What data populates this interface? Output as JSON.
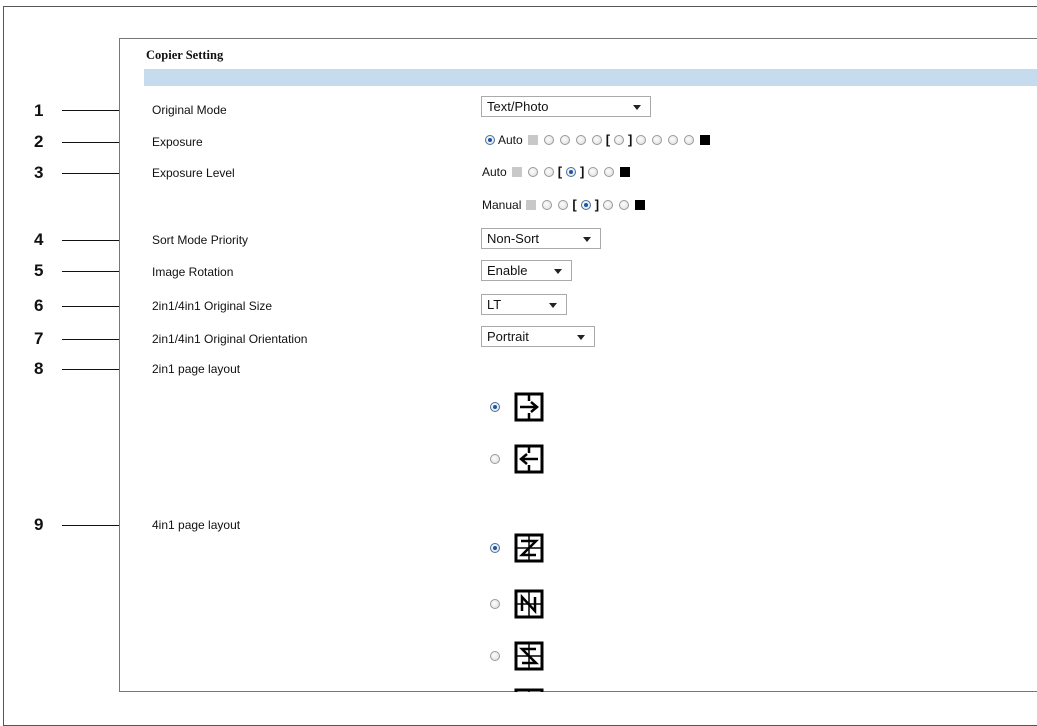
{
  "panel": {
    "title": "Copier Setting"
  },
  "callouts": [
    "1",
    "2",
    "3",
    "4",
    "5",
    "6",
    "7",
    "8",
    "9"
  ],
  "rows": {
    "original_mode": {
      "label": "Original Mode",
      "value": "Text/Photo"
    },
    "exposure": {
      "label": "Exposure",
      "auto_label": "Auto",
      "selected": "Auto"
    },
    "exposure_level": {
      "label": "Exposure Level",
      "auto_label": "Auto",
      "manual_label": "Manual"
    },
    "sort_mode_priority": {
      "label": "Sort Mode Priority",
      "value": "Non-Sort"
    },
    "image_rotation": {
      "label": "Image Rotation",
      "value": "Enable"
    },
    "original_size": {
      "label": "2in1/4in1 Original Size",
      "value": "LT"
    },
    "original_orientation": {
      "label": "2in1/4in1 Original Orientation",
      "value": "Portrait"
    },
    "layout_2in1": {
      "label": "2in1 page layout",
      "options": [
        "left-to-right-icon",
        "right-to-left-icon"
      ],
      "selected_index": 0
    },
    "layout_4in1": {
      "label": "4in1 page layout",
      "options": [
        "z-order-icon",
        "n-order-icon",
        "reverse-z-order-icon",
        "reverse-n-order-icon"
      ],
      "selected_index": 0
    }
  },
  "colors": {
    "band": "#c6dcee",
    "radio_selected": "#1b56a8",
    "border": "#777777"
  }
}
